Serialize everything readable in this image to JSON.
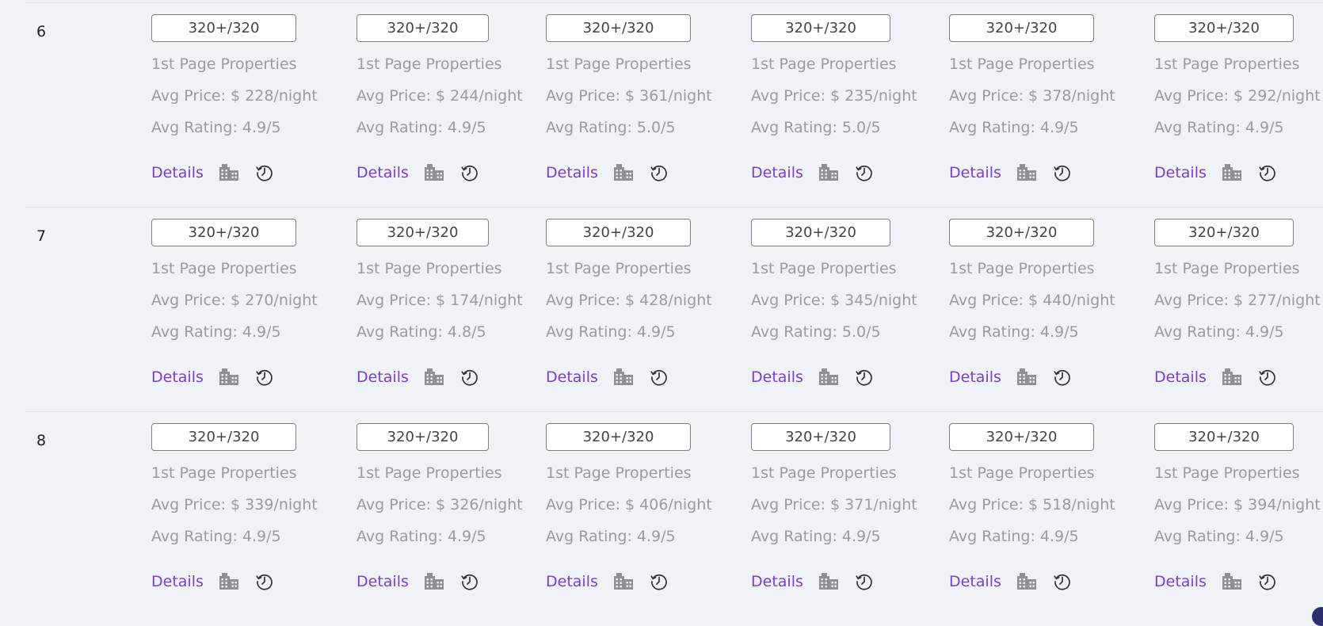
{
  "rows": [
    {
      "num": "6",
      "cells": [
        {
          "rank": "320+/320",
          "label": "1st Page Properties",
          "price": "Avg Price: $ 228/night",
          "rating": "Avg Rating: 4.9/5",
          "details": "Details"
        },
        {
          "rank": "320+/320",
          "label": "1st Page Properties",
          "price": "Avg Price: $ 244/night",
          "rating": "Avg Rating: 4.9/5",
          "details": "Details"
        },
        {
          "rank": "320+/320",
          "label": "1st Page Properties",
          "price": "Avg Price: $ 361/night",
          "rating": "Avg Rating: 5.0/5",
          "details": "Details"
        },
        {
          "rank": "320+/320",
          "label": "1st Page Properties",
          "price": "Avg Price: $ 235/night",
          "rating": "Avg Rating: 5.0/5",
          "details": "Details"
        },
        {
          "rank": "320+/320",
          "label": "1st Page Properties",
          "price": "Avg Price: $ 378/night",
          "rating": "Avg Rating: 4.9/5",
          "details": "Details"
        },
        {
          "rank": "320+/320",
          "label": "1st Page Properties",
          "price": "Avg Price: $ 292/night",
          "rating": "Avg Rating: 4.9/5",
          "details": "Details"
        }
      ]
    },
    {
      "num": "7",
      "cells": [
        {
          "rank": "320+/320",
          "label": "1st Page Properties",
          "price": "Avg Price: $ 270/night",
          "rating": "Avg Rating: 4.9/5",
          "details": "Details"
        },
        {
          "rank": "320+/320",
          "label": "1st Page Properties",
          "price": "Avg Price: $ 174/night",
          "rating": "Avg Rating: 4.8/5",
          "details": "Details"
        },
        {
          "rank": "320+/320",
          "label": "1st Page Properties",
          "price": "Avg Price: $ 428/night",
          "rating": "Avg Rating: 4.9/5",
          "details": "Details"
        },
        {
          "rank": "320+/320",
          "label": "1st Page Properties",
          "price": "Avg Price: $ 345/night",
          "rating": "Avg Rating: 5.0/5",
          "details": "Details"
        },
        {
          "rank": "320+/320",
          "label": "1st Page Properties",
          "price": "Avg Price: $ 440/night",
          "rating": "Avg Rating: 4.9/5",
          "details": "Details"
        },
        {
          "rank": "320+/320",
          "label": "1st Page Properties",
          "price": "Avg Price: $ 277/night",
          "rating": "Avg Rating: 4.9/5",
          "details": "Details"
        }
      ]
    },
    {
      "num": "8",
      "cells": [
        {
          "rank": "320+/320",
          "label": "1st Page Properties",
          "price": "Avg Price: $ 339/night",
          "rating": "Avg Rating: 4.9/5",
          "details": "Details"
        },
        {
          "rank": "320+/320",
          "label": "1st Page Properties",
          "price": "Avg Price: $ 326/night",
          "rating": "Avg Rating: 4.9/5",
          "details": "Details"
        },
        {
          "rank": "320+/320",
          "label": "1st Page Properties",
          "price": "Avg Price: $ 406/night",
          "rating": "Avg Rating: 4.9/5",
          "details": "Details"
        },
        {
          "rank": "320+/320",
          "label": "1st Page Properties",
          "price": "Avg Price: $ 371/night",
          "rating": "Avg Rating: 4.9/5",
          "details": "Details"
        },
        {
          "rank": "320+/320",
          "label": "1st Page Properties",
          "price": "Avg Price: $ 518/night",
          "rating": "Avg Rating: 4.9/5",
          "details": "Details"
        },
        {
          "rank": "320+/320",
          "label": "1st Page Properties",
          "price": "Avg Price: $ 394/night",
          "rating": "Avg Rating: 4.9/5",
          "details": "Details"
        }
      ]
    }
  ],
  "icons": {
    "building": "building-icon",
    "history": "history-icon"
  },
  "colors": {
    "link": "#7b3fd0",
    "muted_text": "#9b9b9b",
    "icon_gray": "#8f8f96",
    "background": "#eff3f8"
  }
}
